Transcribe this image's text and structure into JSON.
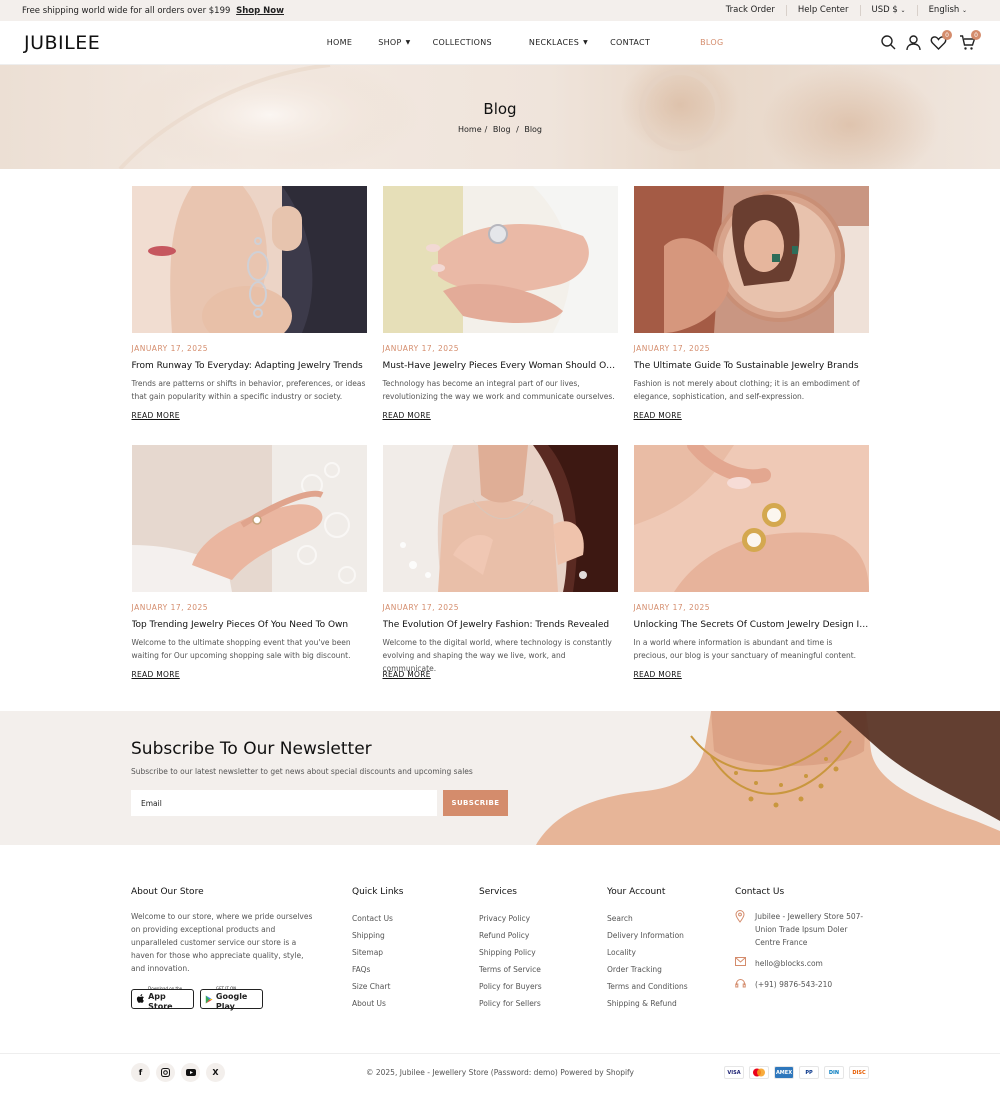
{
  "topbar": {
    "promo_text": "Free shipping world wide for all orders over $199",
    "promo_link": "Shop Now",
    "links": [
      "Track Order",
      "Help Center",
      "USD $",
      "English"
    ]
  },
  "header": {
    "logo": "JUBILEE",
    "nav": [
      {
        "label": "HOME"
      },
      {
        "label": "SHOP"
      },
      {
        "label": "COLLECTIONS"
      },
      {
        "label": "NECKLACES"
      },
      {
        "label": "CONTACT"
      },
      {
        "label": "BLOG"
      }
    ],
    "wishlist_count": "0",
    "cart_count": "0"
  },
  "hero": {
    "title": "Blog",
    "breadcrumb": [
      "Home",
      "Blog",
      "Blog"
    ]
  },
  "posts": [
    {
      "date": "JANUARY 17, 2025",
      "title": "From Runway To Everyday: Adapting Jewelry Trends",
      "excerpt": "Trends are patterns or shifts in behavior, preferences, or ideas that gain popularity within a specific industry or society.",
      "more": "READ MORE"
    },
    {
      "date": "JANUARY 17, 2025",
      "title": "Must-Have Jewelry Pieces Every Woman Should Own",
      "excerpt": "Technology has become an integral part of our lives, revolutionizing the way we work and communicate ourselves.",
      "more": "READ MORE"
    },
    {
      "date": "JANUARY 17, 2025",
      "title": "The Ultimate Guide To Sustainable Jewelry Brands",
      "excerpt": "Fashion is not merely about clothing; it is an embodiment of elegance, sophistication, and self-expression.",
      "more": "READ MORE"
    },
    {
      "date": "JANUARY 17, 2025",
      "title": "Top Trending Jewelry Pieces Of You Need To Own",
      "excerpt": "Welcome to the ultimate shopping event that you've been waiting for Our upcoming shopping sale with big discount.",
      "more": "READ MORE"
    },
    {
      "date": "JANUARY 17, 2025",
      "title": "The Evolution Of Jewelry Fashion: Trends Revealed",
      "excerpt": "Welcome to the digital world, where technology is constantly evolving and shaping the way we live, work, and communicate.",
      "more": "READ MORE"
    },
    {
      "date": "JANUARY 17, 2025",
      "title": "Unlocking The Secrets Of Custom Jewelry Design In...",
      "excerpt": "In a world where information is abundant and time is precious, our blog is your sanctuary of meaningful content.",
      "more": "READ MORE"
    }
  ],
  "newsletter": {
    "title": "Subscribe To Our Newsletter",
    "subtitle": "Subscribe to our latest newsletter to get news about special discounts and upcoming sales",
    "email_placeholder": "Email",
    "button": "SUBSCRIBE"
  },
  "footer": {
    "about": {
      "title": "About Our Store",
      "text": "Welcome to our store, where we pride ourselves on providing exceptional products and unparalleled customer service our store is a haven for those who appreciate quality, style, and innovation.",
      "app_store_small": "Download on the",
      "app_store": "App Store",
      "google_small": "GET IT ON",
      "google": "Google Play"
    },
    "quick_links": {
      "title": "Quick Links",
      "items": [
        "Contact Us",
        "Shipping",
        "Sitemap",
        "FAQs",
        "Size Chart",
        "About Us"
      ]
    },
    "services": {
      "title": "Services",
      "items": [
        "Privacy Policy",
        "Refund Policy",
        "Shipping Policy",
        "Terms of Service",
        "Policy for Buyers",
        "Policy for Sellers"
      ]
    },
    "account": {
      "title": "Your Account",
      "items": [
        "Search",
        "Delivery Information",
        "Locality",
        "Order Tracking",
        "Terms and Conditions",
        "Shipping & Refund"
      ]
    },
    "contact": {
      "title": "Contact Us",
      "address": "Jubilee - Jewellery Store 507-Union Trade Ipsum Doler Centre France",
      "email": "hello@blocks.com",
      "phone": "(+91) 9876-543-210"
    }
  },
  "bottom": {
    "copyright": "© 2025, Jubilee - Jewellery Store (Password: demo) Powered by Shopify",
    "payments": [
      "VISA",
      "MC",
      "AMEX",
      "PP",
      "DIN",
      "DISC"
    ]
  }
}
